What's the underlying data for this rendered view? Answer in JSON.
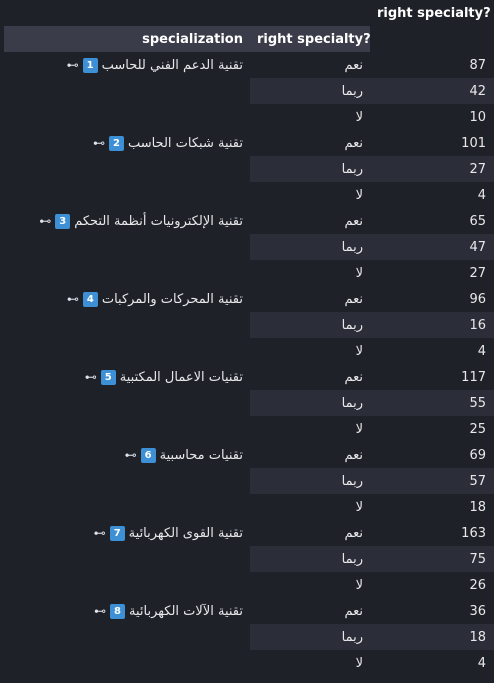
{
  "header": {
    "top_value_header": "right specialty?",
    "spec_header": "specialization",
    "answer_header": "right specialty?"
  },
  "icons": {
    "key": "key-icon",
    "badge_color": "#3d8fd6"
  },
  "groups": [
    {
      "badge": "1",
      "name": "تقنية الدعم الفني للحاسب",
      "rows": [
        {
          "answer": "نعم",
          "value": "87"
        },
        {
          "answer": "ربما",
          "value": "42"
        },
        {
          "answer": "لا",
          "value": "10"
        }
      ]
    },
    {
      "badge": "2",
      "name": "تقنية شبكات الحاسب",
      "rows": [
        {
          "answer": "نعم",
          "value": "101"
        },
        {
          "answer": "ربما",
          "value": "27"
        },
        {
          "answer": "لا",
          "value": "4"
        }
      ]
    },
    {
      "badge": "3",
      "name": "تقنية الإلكترونيات أنظمة التحكم",
      "rows": [
        {
          "answer": "نعم",
          "value": "65"
        },
        {
          "answer": "ربما",
          "value": "47"
        },
        {
          "answer": "لا",
          "value": "27"
        }
      ]
    },
    {
      "badge": "4",
      "name": "تقنية المحركات والمركبات",
      "rows": [
        {
          "answer": "نعم",
          "value": "96"
        },
        {
          "answer": "ربما",
          "value": "16"
        },
        {
          "answer": "لا",
          "value": "4"
        }
      ]
    },
    {
      "badge": "5",
      "name": "تقنيات الاعمال المكتبية",
      "rows": [
        {
          "answer": "نعم",
          "value": "117"
        },
        {
          "answer": "ربما",
          "value": "55"
        },
        {
          "answer": "لا",
          "value": "25"
        }
      ]
    },
    {
      "badge": "6",
      "name": "تقنيات محاسبية",
      "rows": [
        {
          "answer": "نعم",
          "value": "69"
        },
        {
          "answer": "ربما",
          "value": "57"
        },
        {
          "answer": "لا",
          "value": "18"
        }
      ]
    },
    {
      "badge": "7",
      "name": "تقنية القوى الكهربائية",
      "rows": [
        {
          "answer": "نعم",
          "value": "163"
        },
        {
          "answer": "ربما",
          "value": "75"
        },
        {
          "answer": "لا",
          "value": "26"
        }
      ]
    },
    {
      "badge": "8",
      "name": "تقنية الآلات الكهربائية",
      "rows": [
        {
          "answer": "نعم",
          "value": "36"
        },
        {
          "answer": "ربما",
          "value": "18"
        },
        {
          "answer": "لا",
          "value": "4"
        }
      ]
    }
  ]
}
